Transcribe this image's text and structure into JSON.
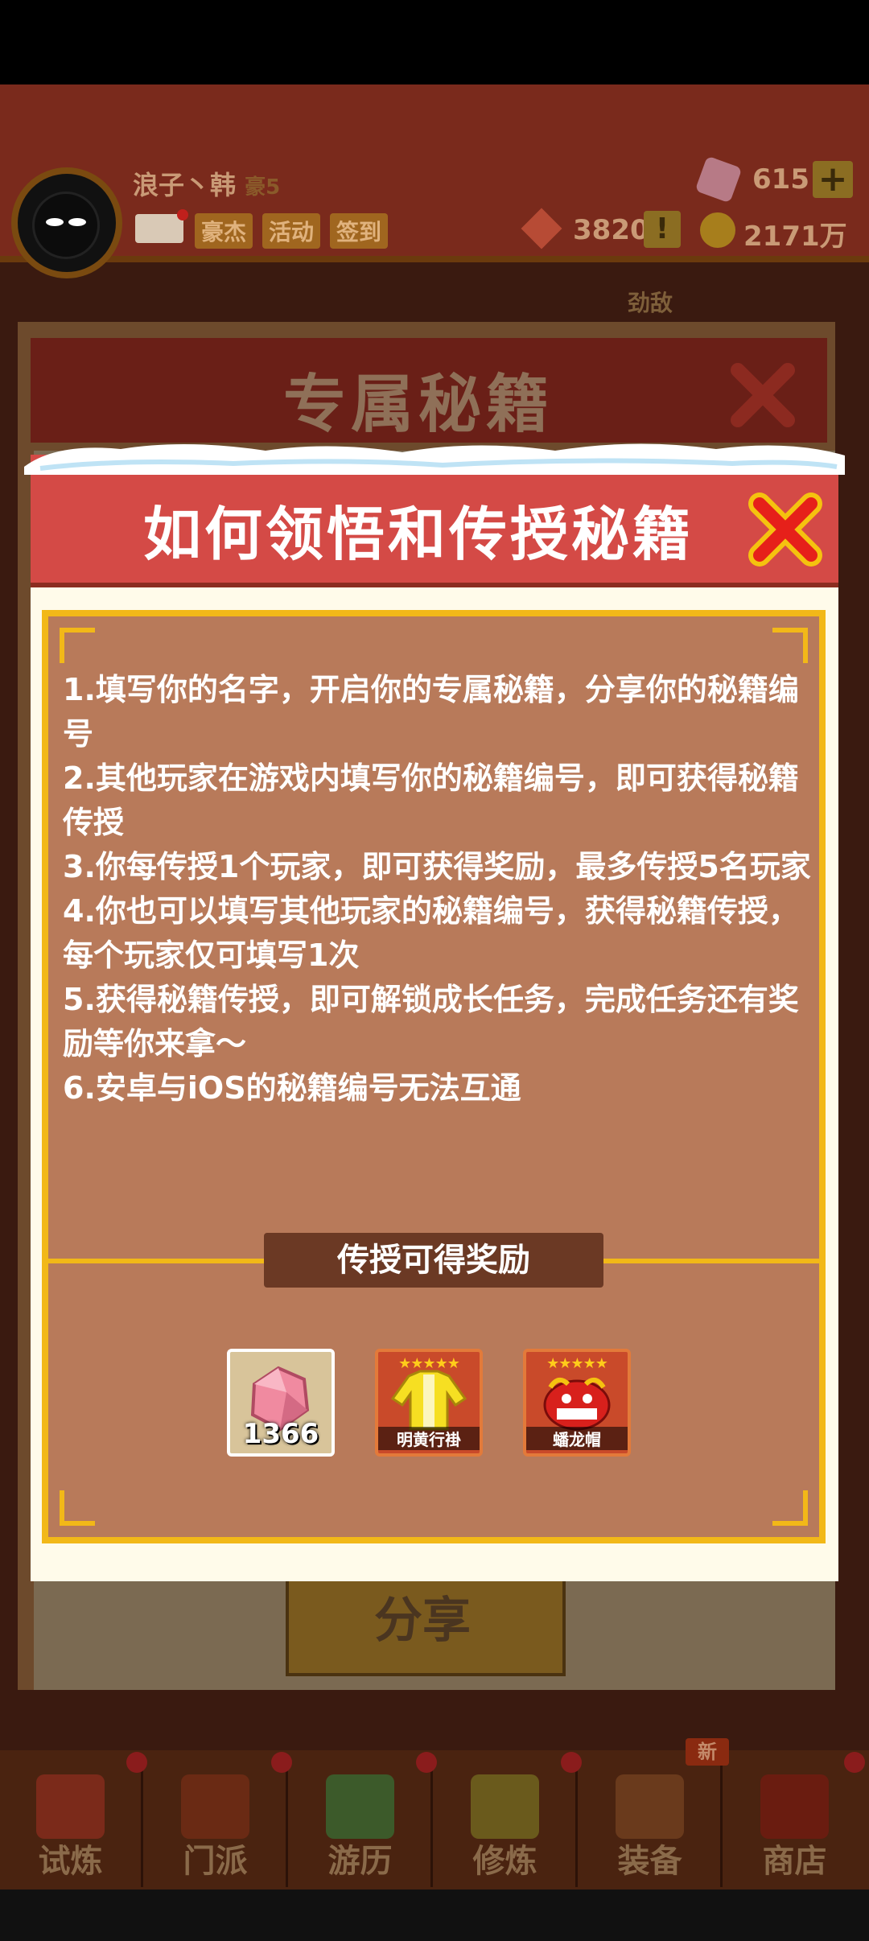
{
  "player": {
    "name": "浪子丶韩",
    "title_badge": "豪5",
    "chips": [
      "豪杰",
      "活动",
      "签到"
    ],
    "gems": "615",
    "power": "3820",
    "coins": "2171万"
  },
  "background": {
    "enemy_label": "劲敌",
    "panel_title": "专属秘籍",
    "share_button": "分享"
  },
  "bottom_nav": {
    "items": [
      {
        "label": "试炼",
        "color": "#7b2a1a"
      },
      {
        "label": "门派",
        "color": "#6a2a14"
      },
      {
        "label": "游历",
        "color": "#3c5a2a"
      },
      {
        "label": "修炼",
        "color": "#6a5a1c"
      },
      {
        "label": "装备",
        "color": "#6a3a1c"
      },
      {
        "label": "商店",
        "color": "#6a1c10"
      }
    ],
    "new_badge": "新"
  },
  "modal": {
    "title": "如何领悟和传授秘籍",
    "rules": [
      "1.填写你的名字，开启你的专属秘籍，分享你的秘籍编号",
      "2.其他玩家在游戏内填写你的秘籍编号，即可获得秘籍传授",
      "3.你每传授1个玩家，即可获得奖励，最多传授5名玩家",
      "4.你也可以填写其他玩家的秘籍编号，获得秘籍传授，每个玩家仅可填写1次",
      "5.获得秘籍传授，即可解锁成长任务，完成任务还有奖励等你来拿～",
      "6.安卓与iOS的秘籍编号无法互通"
    ],
    "reward_header": "传授可得奖励",
    "rewards": [
      {
        "caption": "1366",
        "icon": "gem-icon",
        "stars": ""
      },
      {
        "caption": "明黄行褂",
        "icon": "yellow-robe-icon",
        "stars": "★★★★★"
      },
      {
        "caption": "蟠龙帽",
        "icon": "dragon-hat-icon",
        "stars": "★★★★★"
      }
    ]
  },
  "colors": {
    "modal_header": "#d44a46",
    "frame_gold": "#f2b818",
    "content_bg": "#b87a5a"
  }
}
